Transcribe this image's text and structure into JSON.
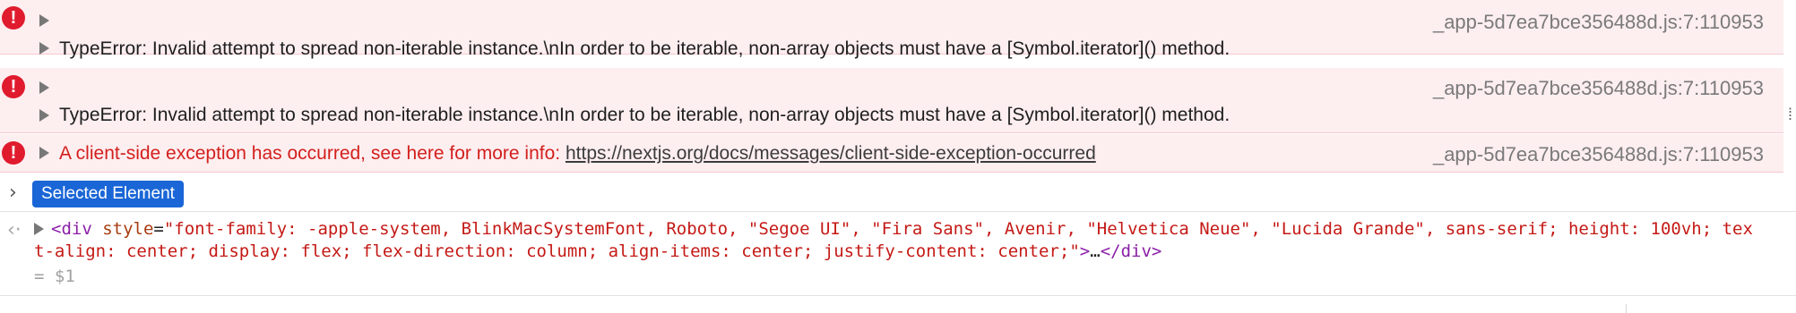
{
  "console": {
    "entries": [
      {
        "message": "TypeError: Invalid attempt to spread non-iterable instance.\\nIn order to be iterable, non-array objects must have a [Symbol.iterator]() method.",
        "source": "_app-5d7ea7bce356488d.js:7:110953"
      },
      {
        "message": "TypeError: Invalid attempt to spread non-iterable instance.\\nIn order to be iterable, non-array objects must have a [Symbol.iterator]() method.",
        "source": "_app-5d7ea7bce356488d.js:7:110953"
      },
      {
        "message": "A client-side exception has occurred, see here for more info: ",
        "link": "https://nextjs.org/docs/messages/client-side-exception-occurred",
        "source": "_app-5d7ea7bce356488d.js:7:110953"
      }
    ],
    "selected_badge": "Selected Element",
    "element": {
      "tag_open": "<div",
      "attr_name": " style",
      "eq": "=",
      "attr_value": "\"font-family: -apple-system, BlinkMacSystemFont, Roboto, \"Segoe UI\", \"Fira Sans\", Avenir, \"Helvetica Neue\", \"Lucida Grande\", sans-serif; height: 100vh; text-align: center; display: flex; flex-direction: column; align-items: center; justify-content: center;\"",
      "tag_mid": ">",
      "ellipsis": "…",
      "tag_close": "</div>"
    },
    "result": "= $1"
  },
  "icons": {
    "error": "error-circle-icon",
    "expand": "disclosure-triangle-icon",
    "prompt": "chevron-right-icon",
    "back": "back-arrow-icon"
  },
  "colors": {
    "error_bg": "#fdeef0",
    "error_icon": "#e01b2e",
    "error_text": "#d3201d",
    "badge_bg": "#1a66d6"
  }
}
